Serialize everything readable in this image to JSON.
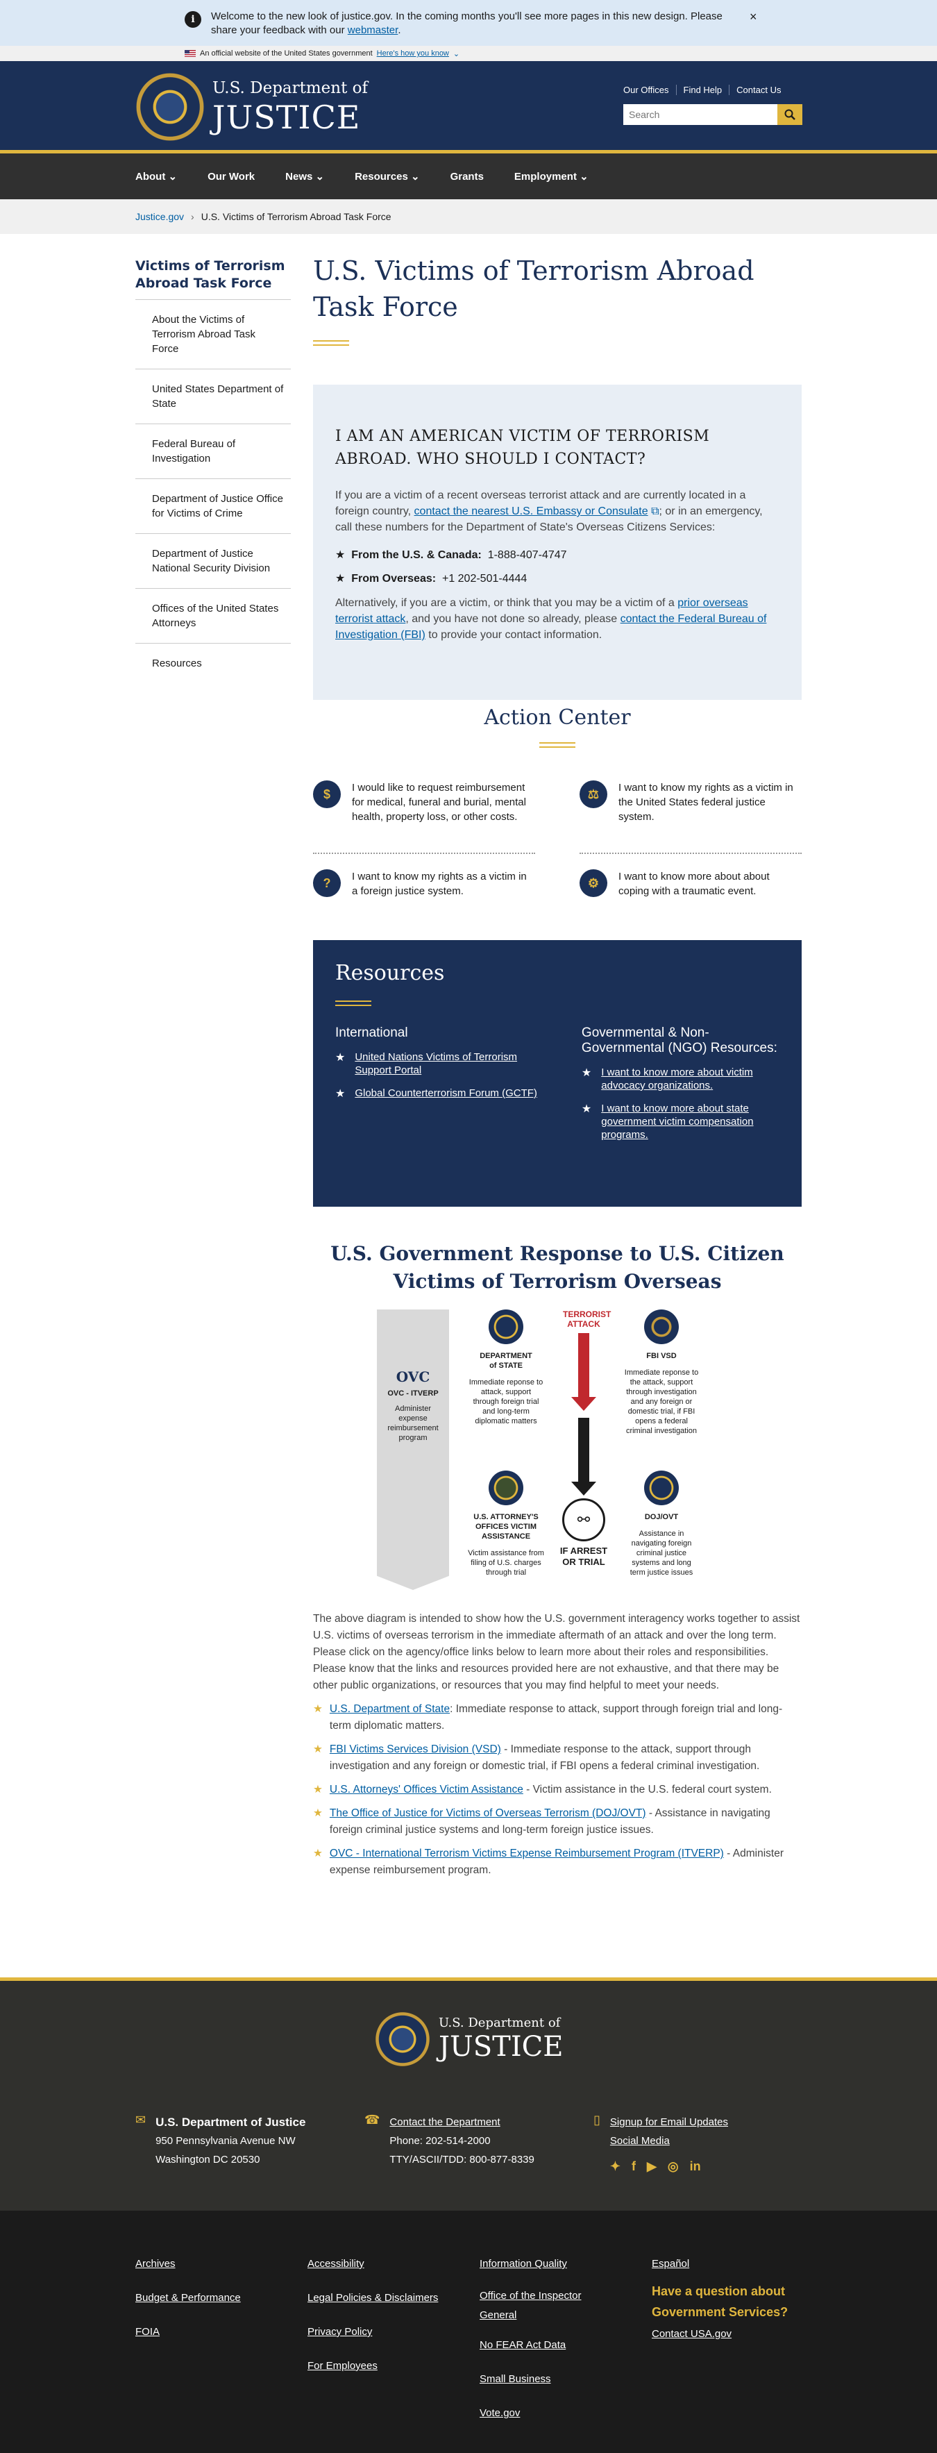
{
  "alert": {
    "text": "Welcome to the new look of justice.gov. In the coming months you'll see more pages in this new design. Please share your feedback with our ",
    "link": "webmaster",
    "end": "."
  },
  "govbanner": {
    "text": "An official website of the United States government",
    "link": "Here's how you know"
  },
  "header": {
    "title_small": "U.S. Department of",
    "title_big": "JUSTICE",
    "links": [
      "Our Offices",
      "Find Help",
      "Contact Us"
    ],
    "search_placeholder": "Search"
  },
  "nav": [
    "About",
    "Our Work",
    "News",
    "Resources",
    "Grants",
    "Employment"
  ],
  "breadcrumb": {
    "home": "Justice.gov",
    "current": "U.S. Victims of Terrorism Abroad Task Force"
  },
  "sidebar": {
    "title": "Victims of Terrorism Abroad Task Force",
    "items": [
      "About the Victims of Terrorism Abroad Task Force",
      "United States Department of State",
      "Federal Bureau of Investigation",
      "Department of Justice Office for Victims of Crime",
      "Department of Justice National Security Division",
      "Offices of the United States Attorneys",
      "Resources"
    ]
  },
  "page": {
    "title": "U.S. Victims of Terrorism Abroad Task Force"
  },
  "callout": {
    "heading": "I AM AN AMERICAN VICTIM OF TERRORISM ABROAD. WHO SHOULD I CONTACT?",
    "p1a": "If you are a victim of a recent overseas terrorist attack and are currently located in a foreign country, ",
    "p1link": "contact the nearest U.S. Embassy or Consulate",
    "p1b": "; or in an emergency, call these numbers for the Department of State's Overseas Citizens Services:",
    "us_label": "From the U.S. & Canada:",
    "us_num": "1-888-407-4747",
    "ov_label": "From Overseas:",
    "ov_num": "+1 202-501-4444",
    "p2a": "Alternatively, if you are a victim, or think that you may be a victim of a ",
    "p2link1": "prior overseas terrorist attack",
    "p2b": ", and you have not done so already, please ",
    "p2link2": "contact the Federal Bureau of Investigation (FBI)",
    "p2c": " to provide your contact information."
  },
  "action": {
    "title": "Action Center",
    "items": [
      "I would like to request reimbursement for medical, funeral and burial, mental health, property loss, or other costs.",
      "I want to know my rights as a victim in the United States federal justice system.",
      "I want to know my rights as a victim in a foreign justice system.",
      "I want to know more about about coping with a traumatic event."
    ],
    "icons": [
      "$",
      "⚖",
      "?",
      "⚙"
    ]
  },
  "resources": {
    "title": "Resources",
    "col1_title": "International",
    "col1": [
      "United Nations Victims of Terrorism Support Portal",
      "Global Counterterrorism Forum (GCTF)"
    ],
    "col2_title": "Governmental & Non-Governmental (NGO) Resources:",
    "col2": [
      "I want to know more about victim advocacy organizations.",
      "I want to know more about state government victim compensation programs."
    ]
  },
  "diagram": {
    "title": "U.S. Government Response to U.S. Citizen Victims of Terrorism Overseas",
    "ovc": "OVC",
    "ovc_sub": "OVC - ITVERP",
    "ovc_desc": "Administer expense reimbursement program",
    "state": "DEPARTMENT of STATE",
    "state_desc": "Immediate reponse to attack, support through foreign trial and long-term diplomatic matters",
    "attack": "TERRORIST ATTACK",
    "fbi": "FBI VSD",
    "fbi_desc": "Immediate reponse to the attack, support through investigation and any foreign or domestic trial, if FBI opens a federal criminal investigation",
    "usao": "U.S. ATTORNEY'S OFFICES VICTIM ASSISTANCE",
    "usao_desc": "Victim assistance from filing of U.S. charges through trial",
    "arrest": "IF ARREST OR TRIAL",
    "ovt": "DOJ/OVT",
    "ovt_desc": "Assistance in navigating foreign criminal justice systems and long term justice issues"
  },
  "explain": {
    "p": "The above diagram is intended to show how the U.S. government interagency works together to assist U.S. victims of overseas terrorism in the immediate aftermath of an attack and over the long term. Please click on the agency/office links below to learn more about their roles and responsibilities. Please know that the links and resources provided here are not exhaustive, and that there may be other public organizations, or resources that you may find helpful to meet your needs.",
    "items": [
      {
        "link": "U.S. Department of State",
        "text": ": Immediate response to attack, support through foreign trial and long-term diplomatic matters."
      },
      {
        "link": "FBI Victims Services Division (VSD)",
        "text": " - Immediate response to the attack, support through investigation and any foreign or domestic trial, if FBI opens a federal criminal investigation."
      },
      {
        "link": "U.S. Attorneys' Offices Victim Assistance",
        "text": " - Victim assistance in the U.S. federal court system."
      },
      {
        "link": "The Office of Justice for Victims of Overseas Terrorism (DOJ/OVT)",
        "text": " - Assistance in navigating foreign criminal justice systems and long-term foreign justice issues."
      },
      {
        "link": "OVC - International Terrorism Victims Expense Reimbursement Program (ITVERP)",
        "text": " - Administer expense reimbursement program."
      }
    ]
  },
  "footer": {
    "dept_small": "U.S. Department of",
    "dept_big": "JUSTICE",
    "addr_title": "U.S. Department of Justice",
    "addr1": "950 Pennsylvania Avenue NW",
    "addr2": "Washington DC 20530",
    "contact": "Contact the Department",
    "phone": "Phone: 202-514-2000",
    "tty": "TTY/ASCII/TDD: 800-877-8339",
    "signup": "Signup for Email Updates",
    "social": "Social Media",
    "col1": [
      "Archives",
      "Budget & Performance",
      "FOIA"
    ],
    "col2": [
      "Accessibility",
      "Legal Policies & Disclaimers",
      "Privacy Policy",
      "For Employees"
    ],
    "col3": [
      "Information Quality",
      "Office of the Inspector General",
      "No FEAR Act Data",
      "Small Business",
      "Vote.gov"
    ],
    "col4_link": "Español",
    "question": "Have a question about Government Services?",
    "usa": "Contact USA.gov"
  }
}
